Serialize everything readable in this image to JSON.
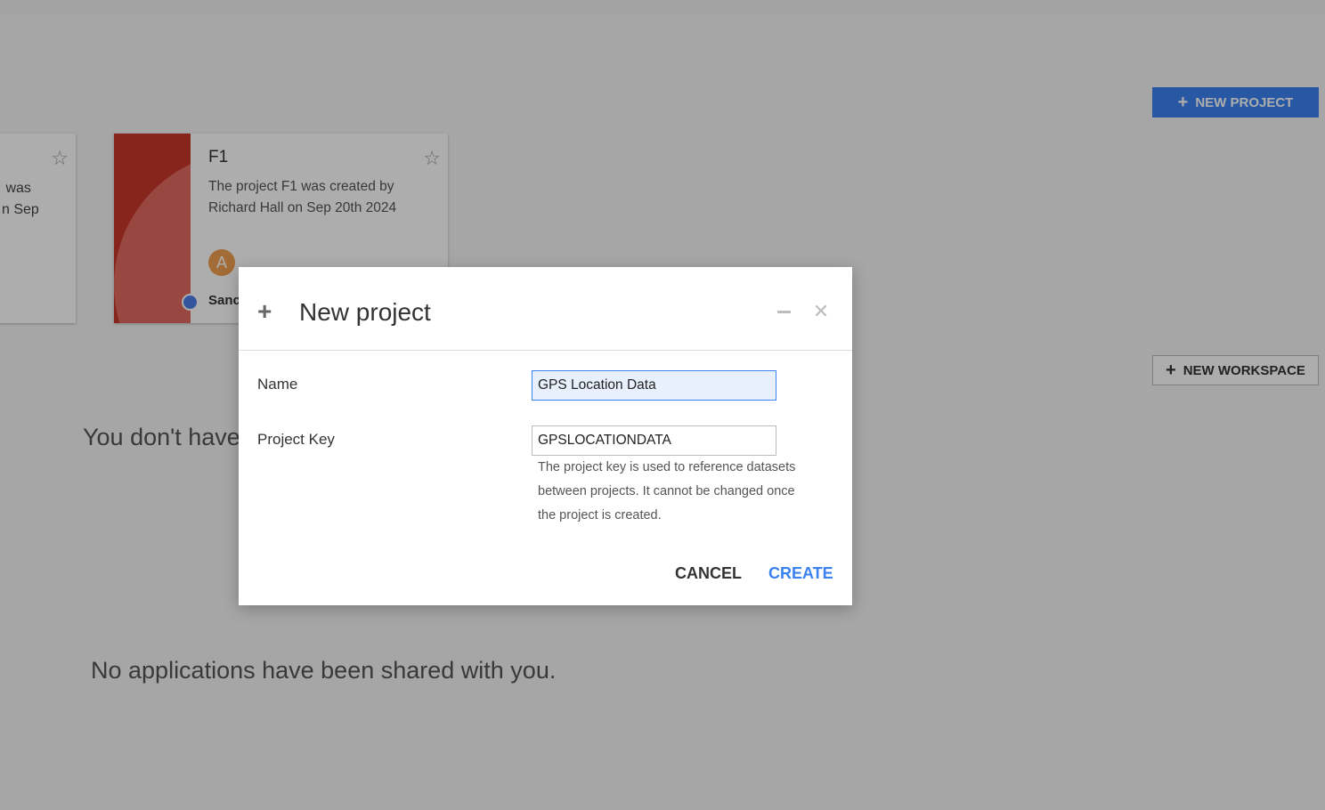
{
  "projects": [
    {
      "description_fragment": " was\nn Sep"
    },
    {
      "title": "F1",
      "description": "The project F1 was created by Richard Hall on Sep 20th 2024",
      "avatar_letter": "A",
      "owner_fragment": "Sanc"
    }
  ],
  "actions": {
    "new_project": "NEW PROJECT",
    "new_workspace": "NEW WORKSPACE"
  },
  "empty_states": {
    "workspaces_fragment": "You don't have",
    "applications": "No applications have been shared with you."
  },
  "modal": {
    "title": "New project",
    "name_label": "Name",
    "name_value": "GPS Location Data",
    "project_key_label": "Project Key",
    "project_key_value": "GPSLOCATIONDATA",
    "project_key_help": "The project key is used to reference datasets between projects. It cannot be changed once the project is created.",
    "cancel_label": "CANCEL",
    "create_label": "CREATE"
  },
  "colors": {
    "accent": "#3b82f0",
    "thumbnail": "#c8352a",
    "avatar": "#f0a050"
  },
  "icons": {
    "favorite": "star-outline-icon",
    "add": "plus-icon",
    "close": "close-icon",
    "minimize": "minimize-icon"
  }
}
